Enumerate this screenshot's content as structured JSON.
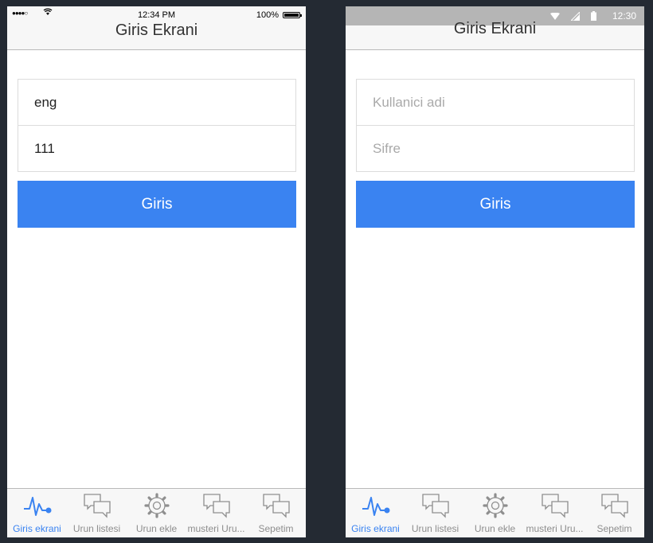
{
  "ios": {
    "status": {
      "time": "12:34 PM",
      "battery": "100%",
      "signal": "●●●●○"
    },
    "title": "Giris Ekrani",
    "username": {
      "value": "eng",
      "placeholder": "Kullanici adi"
    },
    "password": {
      "value": "111",
      "placeholder": "Sifre"
    },
    "button": "Giris",
    "tabs": [
      {
        "label": "Giris ekrani",
        "icon": "pulse-icon",
        "active": true
      },
      {
        "label": "Urun listesi",
        "icon": "chat-icon",
        "active": false
      },
      {
        "label": "Urun ekle",
        "icon": "gear-icon",
        "active": false
      },
      {
        "label": "musteri Uru...",
        "icon": "chat-icon",
        "active": false
      },
      {
        "label": "Sepetim",
        "icon": "chat-icon",
        "active": false
      }
    ]
  },
  "android": {
    "status": {
      "time": "12:30"
    },
    "title": "Giris Ekrani",
    "username": {
      "value": "",
      "placeholder": "Kullanici adi"
    },
    "password": {
      "value": "",
      "placeholder": "Sifre"
    },
    "button": "Giris",
    "tabs": [
      {
        "label": "Giris ekrani",
        "icon": "pulse-icon",
        "active": true
      },
      {
        "label": "Urun listesi",
        "icon": "chat-icon",
        "active": false
      },
      {
        "label": "Urun ekle",
        "icon": "gear-icon",
        "active": false
      },
      {
        "label": "musteri Uru...",
        "icon": "chat-icon",
        "active": false
      },
      {
        "label": "Sepetim",
        "icon": "chat-icon",
        "active": false
      }
    ]
  },
  "colors": {
    "accent": "#3a83f1",
    "background": "#242a33",
    "inactive": "#8e8e8e"
  }
}
